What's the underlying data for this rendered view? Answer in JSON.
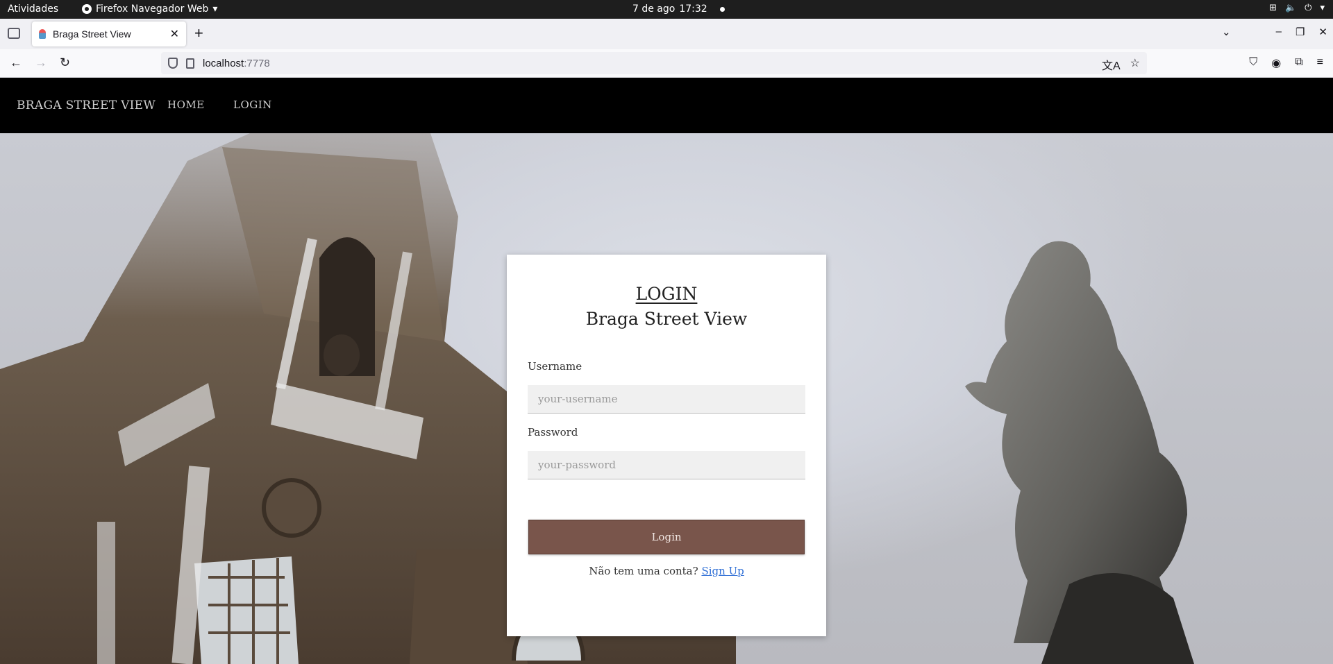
{
  "system_bar": {
    "activities": "Atividades",
    "app_name": "Firefox Navegador Web",
    "date": "7 de ago",
    "time": "17:32"
  },
  "browser": {
    "tab_title": "Braga Street View",
    "url_host": "localhost",
    "url_port": ":7778"
  },
  "site": {
    "brand": "BRAGA STREET VIEW",
    "nav": [
      "HOME",
      "LOGIN"
    ]
  },
  "login_card": {
    "heading": "LOGIN",
    "subheading": "Braga Street View",
    "username_label": "Username",
    "username_placeholder": "your-username",
    "password_label": "Password",
    "password_placeholder": "your-password",
    "submit_label": "Login",
    "signup_prompt": "Não tem uma conta?",
    "signup_link": "Sign Up",
    "accent_color": "#79554b"
  }
}
